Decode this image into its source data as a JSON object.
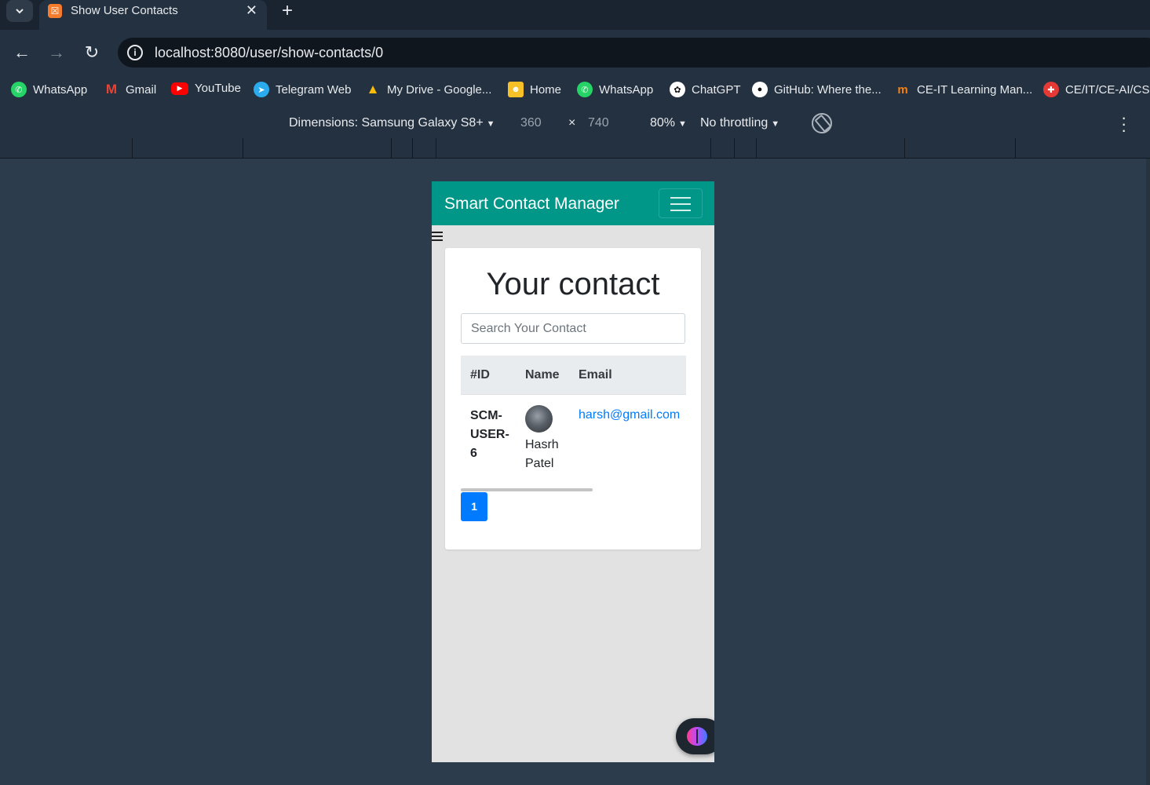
{
  "tab": {
    "title": "Show User Contacts",
    "favicon": "xampp-icon",
    "close": "✕",
    "new_tab": "+"
  },
  "toolbar": {
    "url": "localhost:8080/user/show-contacts/0"
  },
  "bookmarks": [
    {
      "label": "WhatsApp",
      "icon": "whatsapp-icon",
      "color": "#25d366"
    },
    {
      "label": "Gmail",
      "icon": "gmail-icon",
      "color": "#ea4335"
    },
    {
      "label": "YouTube",
      "icon": "youtube-icon",
      "color": "#ff0000"
    },
    {
      "label": "Telegram Web",
      "icon": "telegram-icon",
      "color": "#2aabee"
    },
    {
      "label": "My Drive - Google...",
      "icon": "google-drive-icon",
      "color": "#fbbc04"
    },
    {
      "label": "Home",
      "icon": "classroom-icon",
      "color": "#f6c026"
    },
    {
      "label": "WhatsApp",
      "icon": "whatsapp-icon",
      "color": "#25d366"
    },
    {
      "label": "ChatGPT",
      "icon": "chatgpt-icon",
      "color": "#ffffff"
    },
    {
      "label": "GitHub: Where the...",
      "icon": "github-icon",
      "color": "#ffffff"
    },
    {
      "label": "CE-IT Learning Man...",
      "icon": "moodle-icon",
      "color": "#f98012"
    },
    {
      "label": "CE/IT/CE-AI/CSB",
      "icon": "college-icon",
      "color": "#e53935"
    }
  ],
  "devtools": {
    "dimensions": "Dimensions: Samsung Galaxy S8+",
    "width": "360",
    "times": "×",
    "height": "740",
    "zoom": "80%",
    "throttling": "No throttling"
  },
  "app": {
    "brand": "Smart Contact Manager",
    "heading": "Your contact",
    "search_placeholder": "Search Your Contact",
    "table": {
      "headers": [
        "#ID",
        "Name",
        "Email"
      ],
      "rows": [
        {
          "id": "SCM-USER-6",
          "name": "Hasrh Patel",
          "email": "harsh@gmail.com"
        }
      ]
    },
    "pagination": [
      "1"
    ]
  }
}
